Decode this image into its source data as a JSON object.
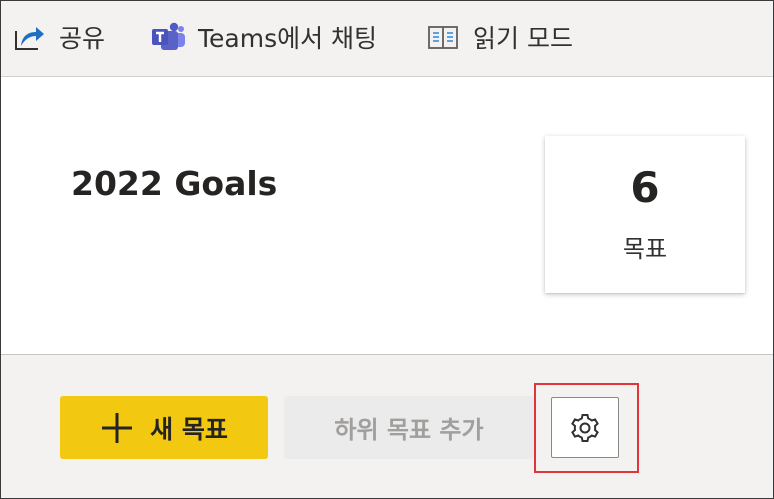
{
  "toolbar": {
    "share_label": "공유",
    "teams_label": "Teams에서 채팅",
    "reading_label": "읽기 모드",
    "icons": [
      "share-icon",
      "teams-icon",
      "reading-mode-icon"
    ]
  },
  "scorecard": {
    "title": "2022 Goals",
    "goal_count": "6",
    "goal_count_label": "목표"
  },
  "actions": {
    "new_goal_label": "새 목표",
    "add_subgoal_label": "하위 목표 추가",
    "settings_icon": "gear-icon",
    "accent_color": "#f2c811",
    "highlight_color": "#e0363b"
  }
}
